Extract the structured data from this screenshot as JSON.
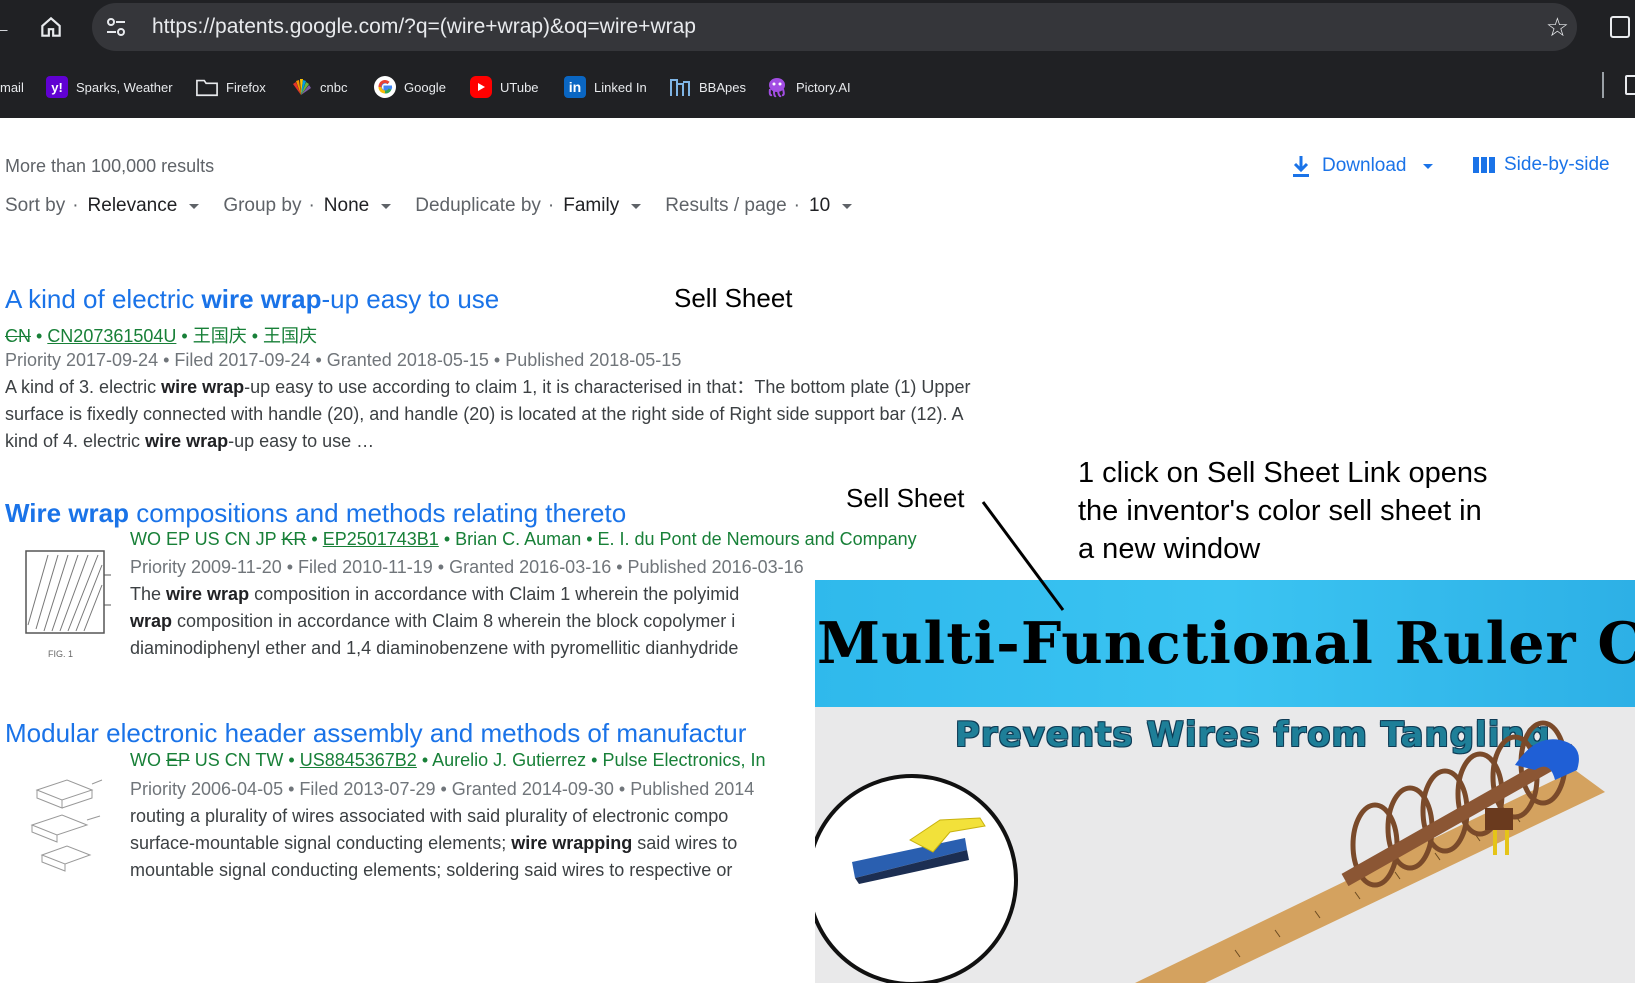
{
  "browser": {
    "url": "https://patents.google.com/?q=(wire+wrap)&oq=wire+wrap",
    "bookmarks": [
      {
        "label": "mail",
        "icon": "mail-icon"
      },
      {
        "label": "Sparks, Weather",
        "icon": "yahoo-icon"
      },
      {
        "label": "Firefox",
        "icon": "folder-icon"
      },
      {
        "label": "cnbc",
        "icon": "nbc-peacock-icon"
      },
      {
        "label": "Google",
        "icon": "google-icon"
      },
      {
        "label": "UTube",
        "icon": "youtube-icon"
      },
      {
        "label": "Linked In",
        "icon": "linkedin-icon"
      },
      {
        "label": "BBApes",
        "icon": "bbapes-icon"
      },
      {
        "label": "Pictory.AI",
        "icon": "pictory-icon"
      }
    ]
  },
  "results_header": {
    "count": "More than 100,000 results",
    "download": "Download",
    "side_by_side": "Side-by-side",
    "filters": [
      {
        "label": "Sort by",
        "value": "Relevance"
      },
      {
        "label": "Group by",
        "value": "None"
      },
      {
        "label": "Deduplicate by",
        "value": "Family"
      },
      {
        "label": "Results / page",
        "value": "10"
      }
    ]
  },
  "results": [
    {
      "title_pre": "A kind of electric ",
      "title_bold": "wire wrap",
      "title_post": "-up easy to use",
      "countries_struck": "CN",
      "countries": "",
      "pub_number": "CN207361504U",
      "parties": "王国庆 • 王国庆",
      "dates": "Priority 2017-09-24 • Filed 2017-09-24 • Granted 2018-05-15 • Published 2018-05-15",
      "snippet_lines": [
        [
          "A kind of 3. electric ",
          "wire wrap",
          "-up easy to use according to claim 1, it is characterised in that：The bottom plate (1) Upper"
        ],
        [
          "surface is fixedly connected with handle (20), and handle (20) is located at the right side of Right side support bar (12). A",
          "",
          ""
        ],
        [
          "kind of 4. electric ",
          "wire wrap",
          "-up easy to use …"
        ]
      ]
    },
    {
      "title_pre": "",
      "title_bold": "Wire wrap",
      "title_post": " compositions and methods relating thereto",
      "countries": "WO EP US CN JP",
      "countries_struck": "KR",
      "pub_number": "EP2501743B1",
      "parties": "Brian C. Auman • E. I. du Pont de Nemours and Company",
      "dates": "Priority 2009-11-20 • Filed 2010-11-19 • Granted 2016-03-16 • Published 2016-03-16",
      "snippet_lines": [
        [
          "The ",
          "wire wrap",
          " composition in accordance with Claim 1 wherein the polyimid"
        ],
        [
          "",
          "wrap",
          " composition in accordance with Claim 8 wherein the block copolymer i"
        ],
        [
          "diaminodiphenyl ether and 1,4 diaminobenzene with pyromellitic dianhydride",
          "",
          ""
        ]
      ],
      "figure_caption": "FIG. 1"
    },
    {
      "title_pre": "Modular electronic header assembly and methods of manufactur",
      "title_bold": "",
      "title_post": "",
      "countries": "WO",
      "countries_struck": "EP",
      "countries_after": "US CN TW",
      "pub_number": "US8845367B2",
      "parties": "Aurelio J. Gutierrez • Pulse Electronics, In",
      "dates": "Priority 2006-04-05 • Filed 2013-07-29 • Granted 2014-09-30 • Published 2014",
      "snippet_lines": [
        [
          "routing a plurality of wires associated with said plurality of electronic compo",
          "",
          ""
        ],
        [
          "surface-mountable signal conducting elements; ",
          "wire wrapping",
          " said wires to"
        ],
        [
          "mountable signal conducting elements; soldering said wires to respective or",
          "",
          ""
        ]
      ]
    }
  ],
  "annotations": {
    "sell_sheet_1": "Sell Sheet",
    "sell_sheet_2": "Sell Sheet",
    "note_lines": [
      "1 click on Sell Sheet Link opens",
      "the inventor's color sell sheet in",
      "a new window"
    ]
  },
  "sell_sheet": {
    "title": "Multi-Functional Ruler Caps",
    "subtitle": "Prevents Wires from Tangling"
  },
  "colors": {
    "link": "#1a73e8",
    "meta_green": "#188038",
    "banner": "#34bcee"
  }
}
